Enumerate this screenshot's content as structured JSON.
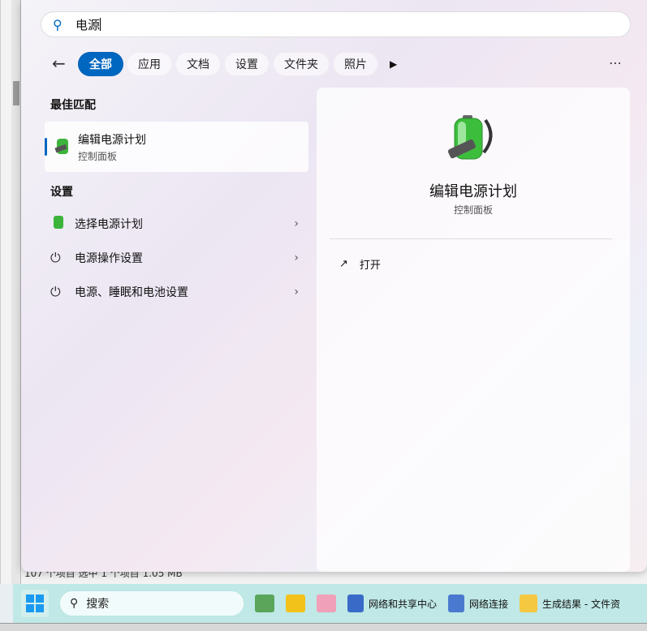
{
  "search": {
    "value": "电源"
  },
  "filters": [
    "全部",
    "应用",
    "文档",
    "设置",
    "文件夹",
    "照片"
  ],
  "best_match": {
    "heading": "最佳匹配",
    "title": "编辑电源计划",
    "subtitle": "控制面板"
  },
  "settings": {
    "heading": "设置",
    "items": [
      "选择电源计划",
      "电源操作设置",
      "电源、睡眠和电池设置"
    ]
  },
  "detail": {
    "title": "编辑电源计划",
    "subtitle": "控制面板",
    "open_label": "打开"
  },
  "background": {
    "status": "107 个项目  选中 1 个项目  1.05 MB"
  },
  "taskbar": {
    "search_placeholder": "搜索",
    "apps": [
      "网络和共享中心",
      "网络连接",
      "生成结果 - 文件资"
    ]
  }
}
